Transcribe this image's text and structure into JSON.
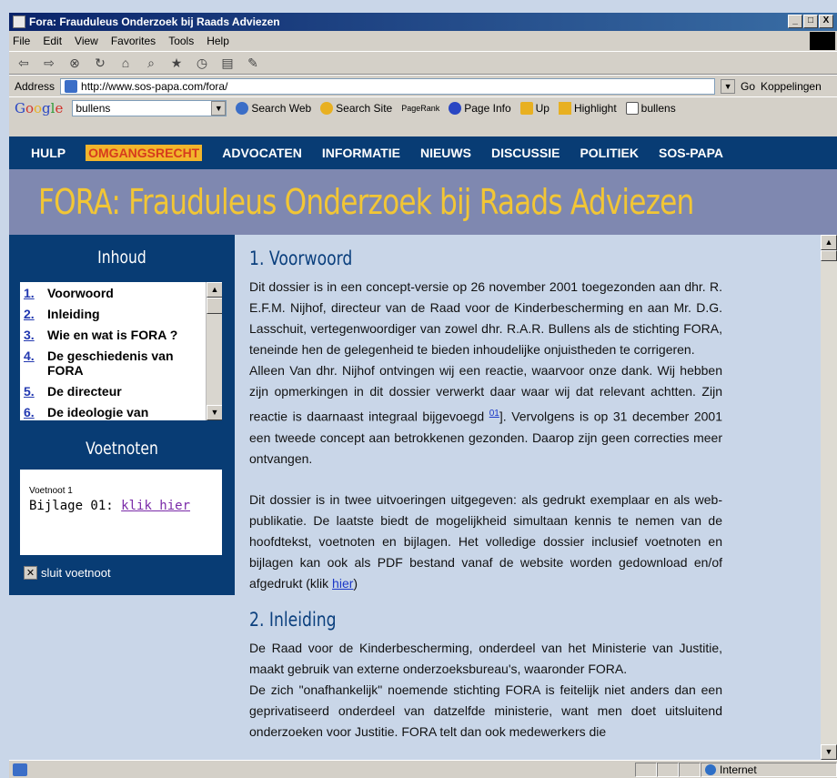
{
  "window": {
    "title": "Fora: Frauduleus Onderzoek bij Raads Adviezen",
    "buttons": [
      "_",
      "□",
      "X"
    ]
  },
  "menu": [
    "File",
    "Edit",
    "View",
    "Favorites",
    "Tools",
    "Help"
  ],
  "toolbar_icons": [
    "back-icon",
    "forward-icon",
    "stop-icon",
    "refresh-icon",
    "home-icon",
    "search-icon",
    "favorites-icon",
    "history-icon",
    "print-icon",
    "edit-icon"
  ],
  "address": {
    "label": "Address",
    "url": "http://www.sos-papa.com/fora/",
    "go": "Go",
    "links": "Koppelingen"
  },
  "google": {
    "logo": "Google",
    "query": "bullens",
    "search_web": "Search Web",
    "search_site": "Search Site",
    "pagerank": "PageRank",
    "page_info": "Page Info",
    "up": "Up",
    "highlight": "Highlight",
    "term": "bullens"
  },
  "nav": {
    "items": [
      "HULP",
      "OMGANGSRECHT",
      "ADVOCATEN",
      "INFORMATIE",
      "NIEUWS",
      "DISCUSSIE",
      "POLITIEK",
      "SOS-PAPA"
    ],
    "active": "OMGANGSRECHT"
  },
  "banner": "FORA: Frauduleus Onderzoek bij Raads Adviezen",
  "sidebar": {
    "inhoud": "Inhoud",
    "toc": [
      {
        "n": "1.",
        "t": "Voorwoord"
      },
      {
        "n": "2.",
        "t": "Inleiding"
      },
      {
        "n": "3.",
        "t": "Wie en wat is FORA ?"
      },
      {
        "n": "4.",
        "t": "De geschiedenis van FORA"
      },
      {
        "n": "5.",
        "t": "De directeur"
      },
      {
        "n": "6.",
        "t": "De ideologie van"
      }
    ],
    "voetnoten": "Voetnoten",
    "note_title": "Voetnoot 1",
    "note_text": "Bijlage 01: ",
    "note_link": "klik hier",
    "close": "sluit voetnoot"
  },
  "content": {
    "h1": "1. Voorwoord",
    "p1": "Dit dossier is in een concept-versie op 26 november 2001 toegezonden aan dhr. R. E.F.M. Nijhof, directeur van de Raad voor de Kinderbescherming en aan Mr. D.G. Lasschuit, vertegenwoordiger van zowel dhr. R.A.R. Bullens als de stichting FORA, teneinde hen de gelegenheid te bieden inhoudelijke onjuistheden te corrigeren.",
    "p2a": "Alleen Van dhr. Nijhof ontvingen wij een reactie, waarvoor onze dank. Wij hebben zijn opmerkingen in dit dossier verwerkt daar waar wij dat relevant achtten. Zijn reactie is daarnaast integraal bijgevoegd ",
    "p2sup": "01",
    "p2b": "]. Vervolgens is op 31 december 2001 een tweede concept aan betrokkenen gezonden. Daarop zijn geen correcties meer ontvangen.",
    "p3": "Dit dossier is in twee uitvoeringen uitgegeven: als gedrukt exemplaar en als web-publikatie. De laatste biedt de mogelijkheid simultaan kennis te nemen van de hoofdtekst, voetnoten en bijlagen. Het volledige dossier inclusief voetnoten en bijlagen kan ook als PDF bestand vanaf de website worden gedownload en/of afgedrukt (klik ",
    "p3link": "hier",
    "p3end": ")",
    "h2": "2. Inleiding",
    "p4": "De Raad voor de Kinderbescherming, onderdeel van het Ministerie van Justitie, maakt gebruik van externe onderzoeksbureau's, waaronder FORA.",
    "p5": "De zich \"onafhankelijk\" noemende stichting FORA is feitelijk niet anders dan een geprivatiseerd onderdeel van datzelfde ministerie, want men doet uitsluitend onderzoeken voor Justitie. FORA telt dan ook medewerkers die"
  },
  "status": {
    "zone": "Internet"
  }
}
